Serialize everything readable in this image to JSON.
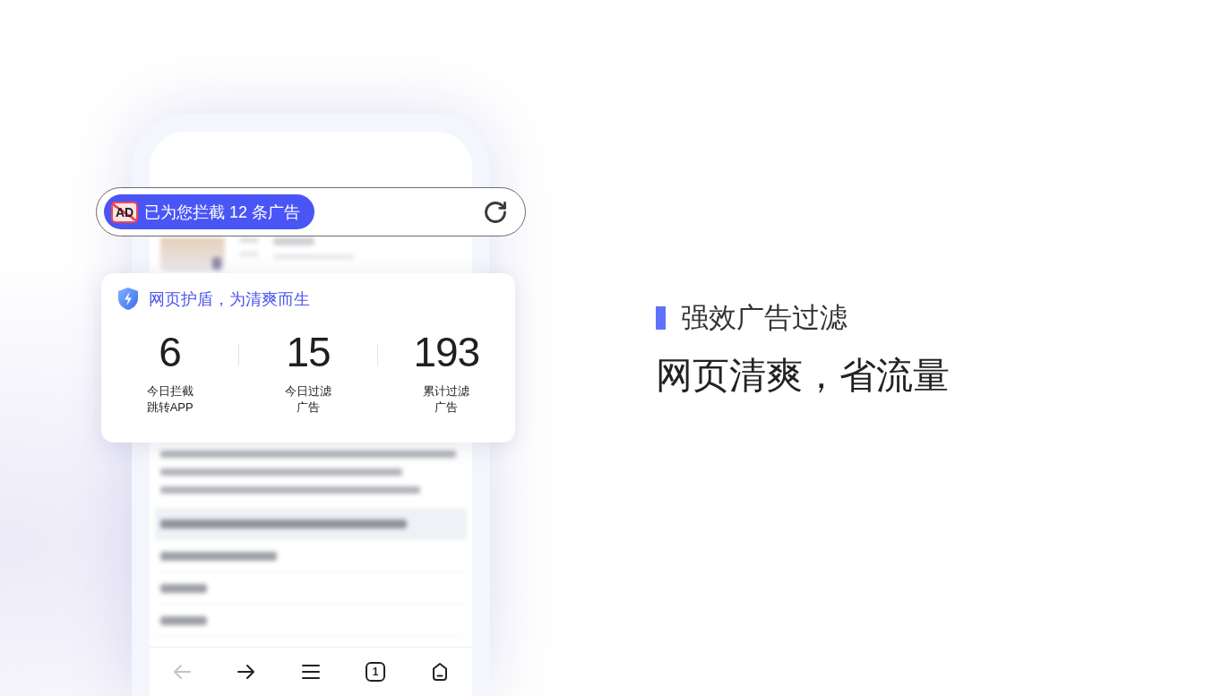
{
  "address_bar": {
    "ad_badge": "AD",
    "message": "已为您拦截 12 条广告"
  },
  "shield_card": {
    "title": "网页护盾，为清爽而生",
    "stats": [
      {
        "value": "6",
        "label": [
          "今日拦截",
          "跳转APP"
        ]
      },
      {
        "value": "15",
        "label": [
          "今日过滤",
          "广告"
        ]
      },
      {
        "value": "193",
        "label": [
          "累计过滤",
          "广告"
        ]
      }
    ]
  },
  "bottom_nav": [
    {
      "kind": "back",
      "disabled": true
    },
    {
      "kind": "forward",
      "disabled": false
    },
    {
      "kind": "menu",
      "disabled": false
    },
    {
      "kind": "tabs",
      "count": "1",
      "disabled": false
    },
    {
      "kind": "home",
      "disabled": false
    }
  ],
  "feature": {
    "subtitle": "强效广告过滤",
    "headline": "网页清爽，省流量"
  }
}
